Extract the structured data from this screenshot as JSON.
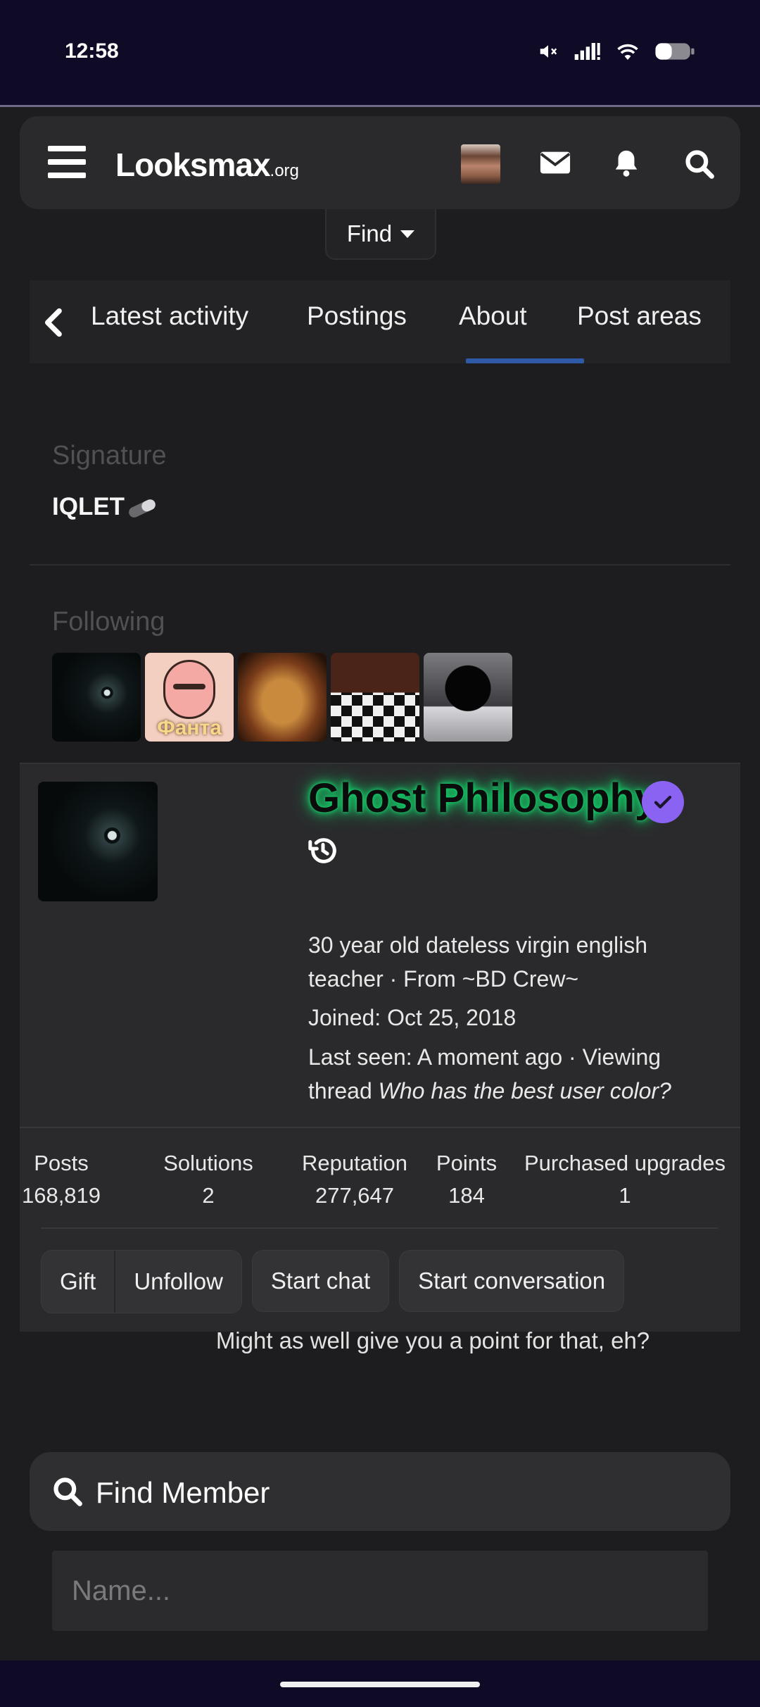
{
  "status_bar": {
    "time": "12:58"
  },
  "header": {
    "logo_main": "Looksmax",
    "logo_suffix": ".org"
  },
  "find_menu": {
    "label": "Find"
  },
  "tabs": [
    {
      "label": "Latest activity",
      "active": false
    },
    {
      "label": "Postings",
      "active": false
    },
    {
      "label": "About",
      "active": true
    },
    {
      "label": "Post areas",
      "active": false
    }
  ],
  "signature": {
    "heading": "Signature",
    "text": "IQLET"
  },
  "following": {
    "heading": "Following",
    "tile_caption": "Фанта"
  },
  "profile": {
    "username": "Ghost Philosophy",
    "name_glow_color": "#12d56b",
    "verified_color": "#8a63f2",
    "bio_line1": "30 year old dateless virgin english",
    "bio_line2": "teacher · From ~BD Crew~",
    "joined": "Joined: Oct 25, 2018",
    "last_seen_line1": "Last seen: A moment ago · Viewing",
    "last_seen_prefix": "thread ",
    "last_seen_thread": "Who has the best user color?"
  },
  "stats": [
    {
      "label": "Posts",
      "value": "168,819"
    },
    {
      "label": "Solutions",
      "value": "2"
    },
    {
      "label": "Reputation",
      "value": "277,647"
    },
    {
      "label": "Points",
      "value": "184"
    },
    {
      "label": "Purchased upgrades",
      "value": "1"
    }
  ],
  "actions": {
    "gift": "Gift",
    "unfollow": "Unfollow",
    "start_chat": "Start chat",
    "start_conversation": "Start conversation"
  },
  "point_message": "Might as well give you a point for that, eh?",
  "find_member": {
    "title": "Find Member",
    "placeholder": "Name..."
  }
}
